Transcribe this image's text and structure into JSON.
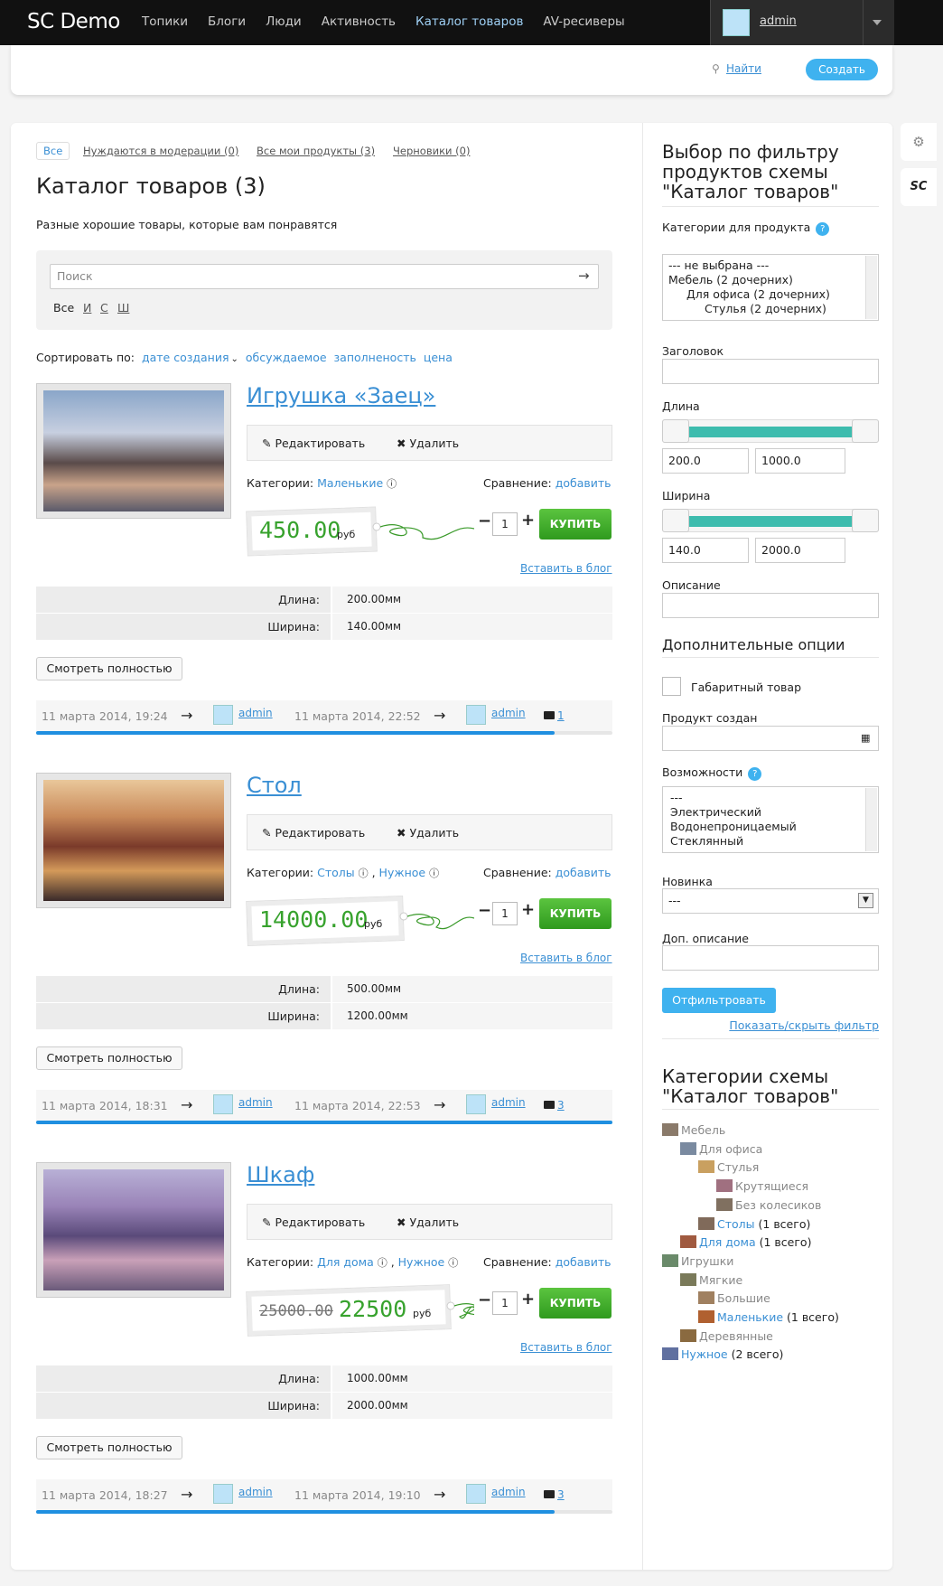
{
  "brand": "SC Demo",
  "nav": [
    "Топики",
    "Блоги",
    "Люди",
    "Активность",
    "Каталог товаров",
    "AV-ресиверы"
  ],
  "nav_active_index": 4,
  "user": {
    "name": "admin"
  },
  "subheader": {
    "search": "Найти",
    "create": "Создать"
  },
  "side_tools": {
    "settings_icon": "gear-icon",
    "sc_label": "SC"
  },
  "filters": {
    "all": "Все",
    "moderation": "Нуждаются в модерации (0)",
    "mine": "Все мои продукты (3)",
    "drafts": "Черновики (0)"
  },
  "page": {
    "title": "Каталог товаров (3)",
    "description": "Разные хорошие товары, которые вам понравятся"
  },
  "search": {
    "placeholder": "Поиск",
    "alphabet": [
      "Все",
      "И",
      "С",
      "Ш"
    ]
  },
  "sort": {
    "label": "Сортировать по:",
    "options": [
      "дате создания",
      "обсуждаемое",
      "заполненость",
      "цена"
    ]
  },
  "labels": {
    "edit": "Редактировать",
    "delete": "Удалить",
    "categories": "Категории:",
    "compare": "Сравнение:",
    "compare_link": "добавить",
    "currency": "руб",
    "buy": "КУПИТЬ",
    "insert_blog": "Вставить в блог",
    "more": "Смотреть полностью",
    "qty": "1",
    "length": "Длина:",
    "width": "Ширина:",
    "arrow": "→"
  },
  "products": [
    {
      "title": "Игрушка «Заец»",
      "categories": [
        "Маленькие"
      ],
      "price": "450.00",
      "old_price": "",
      "length": "200.00мм",
      "width": "140.00мм",
      "created": "11 марта 2014, 19:24",
      "author": "admin",
      "updated": "11 марта 2014, 22:52",
      "editor": "admin",
      "comments": "1",
      "progress": 0.9
    },
    {
      "title": "Стол",
      "categories": [
        "Столы",
        "Нужное"
      ],
      "price": "14000.00",
      "old_price": "",
      "length": "500.00мм",
      "width": "1200.00мм",
      "created": "11 марта 2014, 18:31",
      "author": "admin",
      "updated": "11 марта 2014, 22:53",
      "editor": "admin",
      "comments": "3",
      "progress": 1.0
    },
    {
      "title": "Шкаф",
      "categories": [
        "Для дома",
        "Нужное"
      ],
      "price": "22500",
      "old_price": "25000.00",
      "length": "1000.00мм",
      "width": "2000.00мм",
      "created": "11 марта 2014, 18:27",
      "author": "admin",
      "updated": "11 марта 2014, 19:10",
      "editor": "admin",
      "comments": "3",
      "progress": 0.9
    }
  ],
  "sidebar": {
    "title": "Выбор по фильтру продуктов схемы \"Каталог товаров\"",
    "categories_label": "Категории для продукта",
    "categories_options": [
      "--- не выбрана ---",
      "Мебель (2 дочерних)",
      "Для офиса (2 дочерних)",
      "Стулья (2 дочерних)"
    ],
    "heading_label": "Заголовок",
    "length_label": "Длина",
    "length_min": "200.0",
    "length_max": "1000.0",
    "width_label": "Ширина",
    "width_min": "140.0",
    "width_max": "2000.0",
    "description_label": "Описание",
    "extra_title": "Дополнительные опции",
    "bulky_label": "Габаритный товар",
    "created_label": "Продукт создан",
    "features_label": "Возможности",
    "features_options": [
      "---",
      "Электрический",
      "Водонепроницаемый",
      "Стеклянный"
    ],
    "novelty_label": "Новинка",
    "novelty_value": "---",
    "extra_desc_label": "Доп. описание",
    "filter_button": "Отфильтровать",
    "toggle_filter": "Показать/скрыть фильтр",
    "cat_title": "Категории схемы \"Каталог товаров\"",
    "tree": [
      {
        "label": "Мебель",
        "count": "",
        "link": false
      },
      {
        "label": "Для офиса",
        "count": "",
        "link": false
      },
      {
        "label": "Стулья",
        "count": "",
        "link": false
      },
      {
        "label": "Крутящиеся",
        "count": "",
        "link": false
      },
      {
        "label": "Без колесиков",
        "count": "",
        "link": false
      },
      {
        "label": "Столы",
        "count": "(1 всего)",
        "link": true
      },
      {
        "label": "Для дома",
        "count": "(1 всего)",
        "link": true
      },
      {
        "label": "Игрушки",
        "count": "",
        "link": false
      },
      {
        "label": "Мягкие",
        "count": "",
        "link": false
      },
      {
        "label": "Большие",
        "count": "",
        "link": false
      },
      {
        "label": "Маленькие",
        "count": "(1 всего)",
        "link": true
      },
      {
        "label": "Деревянные",
        "count": "",
        "link": false
      },
      {
        "label": "Нужное",
        "count": "(2 всего)",
        "link": true
      }
    ]
  }
}
